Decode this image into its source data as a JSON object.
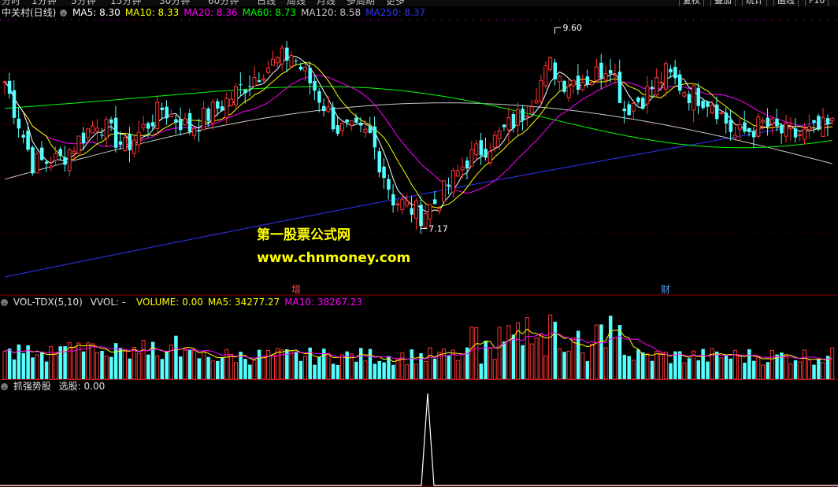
{
  "toolbar": {
    "items": [
      "分时",
      "1分钟",
      "5分钟",
      "15分钟",
      "30分钟",
      "60分钟",
      "日线",
      "周线",
      "月线",
      "多周期",
      "更多"
    ],
    "right_buttons": [
      "复权",
      "叠加",
      "统计",
      "画线",
      "F10"
    ]
  },
  "main_panel": {
    "stock": "中关村(日线)",
    "ma_labels": [
      {
        "text": "MA5: 8.30",
        "color": "#ffffff"
      },
      {
        "text": "MA10: 8.33",
        "color": "#ffff00"
      },
      {
        "text": "MA20: 8.36",
        "color": "#ff00ff"
      },
      {
        "text": "MA60: 8.73",
        "color": "#00ff00"
      },
      {
        "text": "MA120: 8.58",
        "color": "#c8c8c8"
      },
      {
        "text": "MA250: 8.37",
        "color": "#3333ff"
      }
    ],
    "high_marker": "9.60",
    "low_marker": "7.17",
    "event_tags": [
      {
        "text": "增",
        "color": "#ff4444"
      },
      {
        "text": "财",
        "color": "#4da6ff"
      }
    ]
  },
  "watermark": {
    "line1": "第一股票公式网",
    "line2": "www.chnmoney.com",
    "color": "#ffff00"
  },
  "volume_panel": {
    "indicator": "VOL-TDX(5,10)",
    "vvol": "VVOL: -",
    "labels": [
      {
        "text": "VOLUME: 0.00",
        "color": "#ffff00"
      },
      {
        "text": "MA5: 34277.27",
        "color": "#ffff00"
      },
      {
        "text": "MA10: 38267.23",
        "color": "#ff00ff"
      }
    ]
  },
  "signal_panel": {
    "indicator": "抓强势股",
    "label": "选股: 0.00"
  },
  "chart_data": {
    "type": "candlestick",
    "title": "中关村(日线)",
    "price_range": [
      6.4,
      9.75
    ],
    "price_high": 9.6,
    "price_low": 7.17,
    "colors": {
      "up": "#ff3232",
      "down": "#54ffff",
      "ma5": "#ffffff",
      "ma10": "#ffff00",
      "ma20": "#ff00ff",
      "ma60": "#00ff00",
      "ma120": "#c8c8c8",
      "ma250": "#3333ff"
    },
    "close_anchors": [
      [
        0,
        8.95
      ],
      [
        6,
        7.9
      ],
      [
        12,
        7.95
      ],
      [
        20,
        8.45
      ],
      [
        26,
        8.1
      ],
      [
        34,
        8.6
      ],
      [
        40,
        8.35
      ],
      [
        48,
        8.7
      ],
      [
        56,
        9.12
      ],
      [
        62,
        9.3
      ],
      [
        67,
        8.85
      ],
      [
        72,
        8.35
      ],
      [
        79,
        8.25
      ],
      [
        84,
        7.45
      ],
      [
        90,
        7.25
      ],
      [
        94,
        7.45
      ],
      [
        100,
        7.95
      ],
      [
        106,
        8.2
      ],
      [
        112,
        8.55
      ],
      [
        118,
        9.15
      ],
      [
        121,
        8.95
      ],
      [
        127,
        9.0
      ],
      [
        131,
        9.2
      ],
      [
        134,
        8.6
      ],
      [
        138,
        8.75
      ],
      [
        143,
        9.05
      ],
      [
        148,
        8.8
      ],
      [
        153,
        8.7
      ],
      [
        158,
        8.25
      ],
      [
        164,
        8.4
      ],
      [
        170,
        8.25
      ],
      [
        175,
        8.3
      ],
      [
        179,
        8.38
      ]
    ],
    "volume_scale": 100000,
    "volume_ma5_last": 34277.27,
    "volume_ma10_last": 38267.23,
    "signal_value": 0.0
  }
}
